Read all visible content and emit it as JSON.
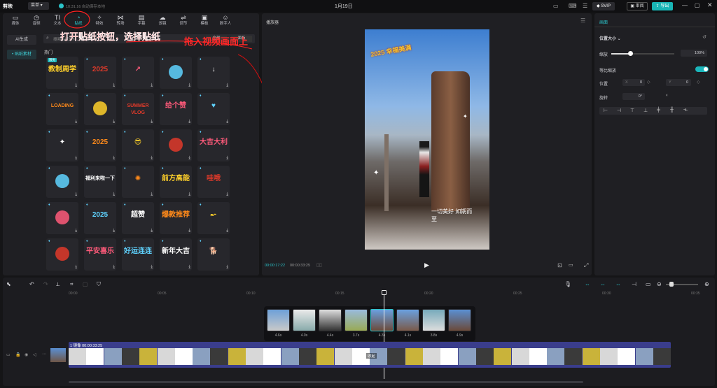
{
  "app": {
    "name": "剪映",
    "menu": "菜单",
    "status": "10:31:16 自动保存本地",
    "title": "1月19日",
    "svip": "SVIP",
    "review": "审阅",
    "export": "导出"
  },
  "toolbar": [
    {
      "id": "media",
      "label": "媒体",
      "icon": "▭"
    },
    {
      "id": "audio",
      "label": "音频",
      "icon": "◷"
    },
    {
      "id": "text",
      "label": "文本",
      "icon": "TI"
    },
    {
      "id": "sticker",
      "label": "贴纸",
      "icon": "◔"
    },
    {
      "id": "effects",
      "label": "特效",
      "icon": "✧"
    },
    {
      "id": "transition",
      "label": "转场",
      "icon": "⋈"
    },
    {
      "id": "subtitle",
      "label": "字幕",
      "icon": "▤"
    },
    {
      "id": "filter",
      "label": "滤镜",
      "icon": "☁"
    },
    {
      "id": "adjust",
      "label": "调节",
      "icon": "⇌"
    },
    {
      "id": "template",
      "label": "模板",
      "icon": "▣"
    },
    {
      "id": "avatar",
      "label": "数字人",
      "icon": "☺"
    }
  ],
  "sidebar": {
    "ai": "AI生成",
    "material": "• 贴纸素材"
  },
  "search": {
    "placeholder": "搜索贴纸素材，如“手绘”",
    "all": "全部",
    "tabs": [
      "全部",
      "面板"
    ]
  },
  "section": "热门",
  "annotations": {
    "step1": "打开贴纸按钮，选择贴纸",
    "step2": "拖入视频画面上"
  },
  "stickers": [
    [
      "教制周学",
      "2025",
      "↗",
      "",
      "↓"
    ],
    [
      "LOADING",
      "",
      "SUMMER VLOG",
      "给个赞",
      "♥"
    ],
    [
      "✦",
      "2025",
      "😎",
      "",
      "大吉大利"
    ],
    [
      "",
      "福利来啦一下",
      "✺",
      "前方高能",
      "哇哦"
    ],
    [
      "",
      "2025",
      "超赞",
      "爆款推荐",
      "↜"
    ],
    [
      "",
      "平安喜乐",
      "好运连连",
      "新年大吉",
      "🐕"
    ]
  ],
  "sticker_badge": "限免",
  "player": {
    "title": "播放器",
    "current": "00:00:17:22",
    "total": "00:00:33:25",
    "overlay": "2025 幸福美满",
    "sign": "一切美好 如期而至"
  },
  "props": {
    "tab": "画面",
    "section": "位置大小",
    "scale_label": "缩放",
    "scale_value": "100%",
    "scale_fraction": 0.3,
    "uniform": "等比缩放",
    "pos_label": "位置",
    "x_label": "X",
    "x_val": "0",
    "y_label": "Y",
    "y_val": "0",
    "rot_label": "旋转",
    "rot_val": "0°"
  },
  "timeline": {
    "ticks": [
      "00:00",
      "00:05",
      "00:10",
      "00:15",
      "00:20",
      "00:25",
      "00:30",
      "00:35"
    ],
    "thumbs": [
      {
        "dur": "4.6s"
      },
      {
        "dur": "4.0s"
      },
      {
        "dur": "4.4s"
      },
      {
        "dur": "3.7s"
      },
      {
        "dur": "4.3s"
      },
      {
        "dur": "4.1s"
      },
      {
        "dur": "3.8s"
      },
      {
        "dur": "4.9s"
      }
    ],
    "clip_label": "1 镜像  00:00:33:25",
    "clip_tag": "收起"
  }
}
